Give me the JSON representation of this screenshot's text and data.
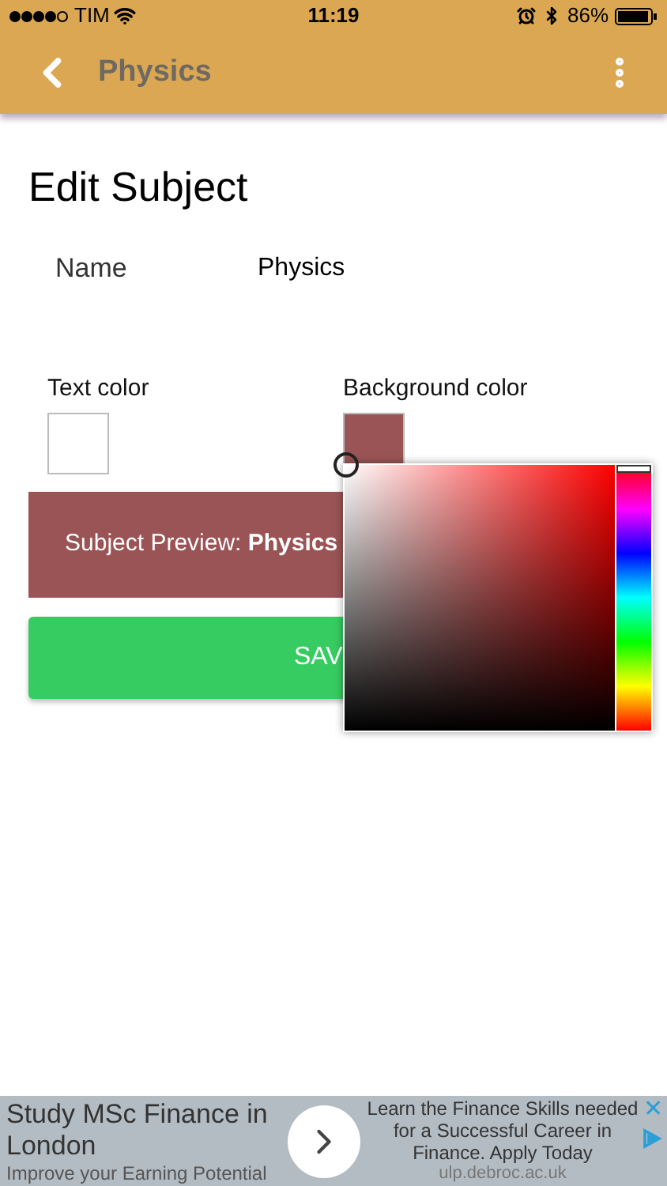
{
  "status_bar": {
    "carrier": "TIM",
    "time": "11:19",
    "battery": "86%"
  },
  "app_bar": {
    "title": "Physics"
  },
  "heading": "Edit Subject",
  "name_field": {
    "label": "Name",
    "value": "Physics"
  },
  "color_swatches": [
    {
      "label": "Text color",
      "color": "#ffffff"
    },
    {
      "label": "Background color",
      "color": "#9b5455"
    }
  ],
  "preview": {
    "text": "Subject Preview: **Physics**"
  },
  "save_button": {
    "label": "SAV"
  },
  "color_picker": {
    "hue": {
      "level": 0
    }
  },
  "ad": {
    "headline": "Study MSc Finance in London",
    "subline": "Improve your Earning Potential",
    "body": "Learn the Finance Skills needed for a Successful Career in Finance. Apply Today",
    "url": "ulp.debroc.ac.uk",
    "close": "✕"
  }
}
